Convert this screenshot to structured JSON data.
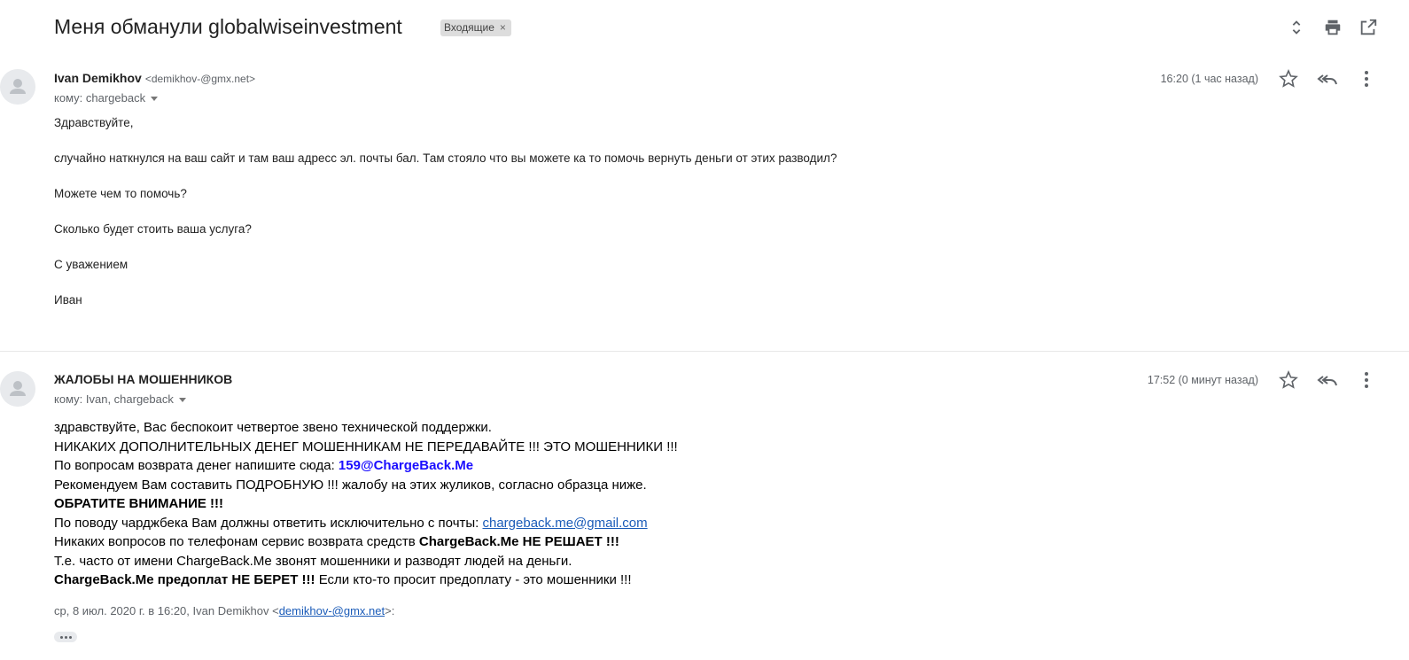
{
  "thread": {
    "subject": "Меня обманули globalwiseinvestment",
    "label": "Входящие",
    "label_close": "×"
  },
  "icons": {
    "expand": "unfold-icon",
    "print": "print-icon",
    "popout": "open-in-new-window-icon",
    "star": "star-icon",
    "reply": "reply-all-icon",
    "more": "more-vert-icon",
    "avatar": "person-icon"
  },
  "messages": [
    {
      "sender_name": "Ivan Demikhov",
      "sender_email": "<demikhov-@gmx.net>",
      "recipient": "кому: chargeback",
      "time": "16:20 (1 час назад)",
      "body": [
        "Здравствуйте,",
        "случайно наткнулся на ваш сайт и там ваш адресс эл. почты бал. Там стояло что вы можете ка то помочь вернуть деньги от этих разводил?",
        "Можете чем то помочь?",
        "Сколько будет стоить ваша услуга?",
        "С уважением",
        "Иван"
      ]
    },
    {
      "sender_name": "ЖАЛОБЫ НА МОШЕННИКОВ",
      "recipient": "кому: Ivan, chargeback",
      "time": "17:52 (0 минут назад)",
      "body": {
        "line1": "здравствуйте, Вас беспокоит четвертое звено технической поддержки.",
        "line2": "НИКАКИХ ДОПОЛНИТЕЛЬНЫХ ДЕНЕГ МОШЕННИКАМ НЕ ПЕРЕДАВАЙТЕ !!! ЭТО МОШЕННИКИ !!!",
        "line3_prefix": "По вопросам возврата денег напишите сюда: ",
        "line3_link": "159@ChargeBack.Me",
        "line4": "Рекомендуем Вам составить ПОДРОБНУЮ !!! жалобу на этих жуликов, согласно образца ниже.",
        "line5": "ОБРАТИТЕ ВНИМАНИЕ !!!",
        "line6_prefix": "По поводу чарджбека Вам должны ответить исключительно с почты: ",
        "line6_link": "chargeback.me@gmail.com",
        "line7_prefix": "Никаких вопросов по телефонам сервис возврата средств ",
        "line7_bold": "ChargeBack.Me НЕ РЕШАЕТ !!!",
        "line8": "Т.е. часто от имени ChargeBack.Me звонят мошенники и разводят людей на деньги.",
        "line9_bold": "ChargeBack.Me предоплат НЕ БЕРЕТ !!!",
        "line9_suffix": " Если кто-то просит предоплату - это мошенники !!!"
      },
      "quote_prefix": "ср, 8 июл. 2020 г. в 16:20, Ivan Demikhov <",
      "quote_link": "demikhov-@gmx.net",
      "quote_suffix": ">:"
    }
  ]
}
